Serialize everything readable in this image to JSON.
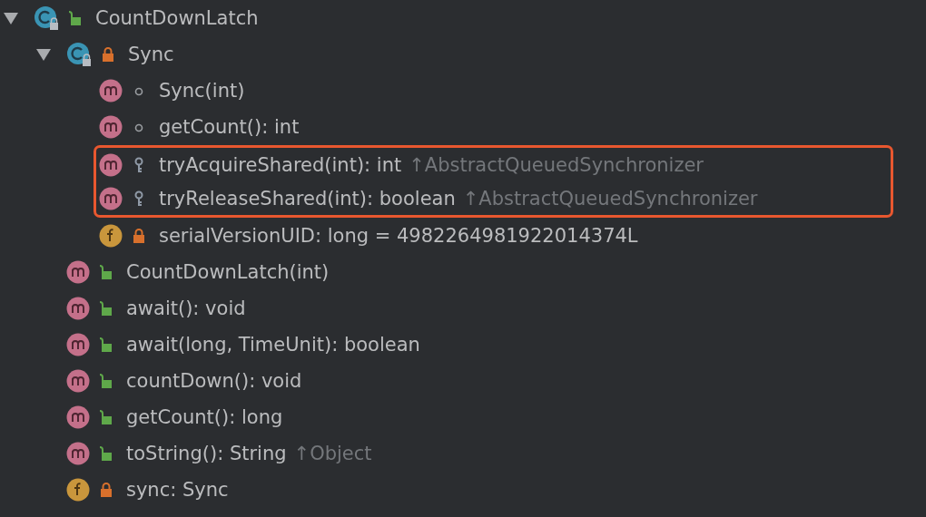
{
  "tree": [
    {
      "kind": "class",
      "access": {
        "kind": "public"
      },
      "label": "CountDownLatch",
      "expanded": true,
      "highlighted": false,
      "children": [
        {
          "kind": "class",
          "access": {
            "kind": "private"
          },
          "label": "Sync",
          "expanded": true,
          "highlighted": false,
          "children": [
            {
              "kind": "method",
              "access": {
                "kind": "package"
              },
              "label": "Sync(int)",
              "highlighted": false
            },
            {
              "kind": "method",
              "access": {
                "kind": "package"
              },
              "label": "getCount(): int",
              "highlighted": false
            },
            {
              "kind": "method",
              "access": {
                "kind": "protected"
              },
              "label": "tryAcquireShared(int): int",
              "inherited": "↑AbstractQueuedSynchronizer",
              "highlighted": true
            },
            {
              "kind": "method",
              "access": {
                "kind": "protected"
              },
              "label": "tryReleaseShared(int): boolean",
              "inherited": "↑AbstractQueuedSynchronizer",
              "highlighted": true
            },
            {
              "kind": "field",
              "access": {
                "kind": "private"
              },
              "label": "serialVersionUID: long = 4982264981922014374L",
              "highlighted": false
            }
          ]
        },
        {
          "kind": "method",
          "access": {
            "kind": "public"
          },
          "label": "CountDownLatch(int)",
          "highlighted": false
        },
        {
          "kind": "method",
          "access": {
            "kind": "public"
          },
          "label": "await(): void",
          "highlighted": false
        },
        {
          "kind": "method",
          "access": {
            "kind": "public"
          },
          "label": "await(long, TimeUnit): boolean",
          "highlighted": false
        },
        {
          "kind": "method",
          "access": {
            "kind": "public"
          },
          "label": "countDown(): void",
          "highlighted": false
        },
        {
          "kind": "method",
          "access": {
            "kind": "public"
          },
          "label": "getCount(): long",
          "highlighted": false
        },
        {
          "kind": "method",
          "access": {
            "kind": "public"
          },
          "label": "toString(): String",
          "inherited": "↑Object",
          "highlighted": false
        },
        {
          "kind": "field",
          "access": {
            "kind": "private"
          },
          "label": "sync: Sync",
          "highlighted": false
        }
      ]
    }
  ]
}
